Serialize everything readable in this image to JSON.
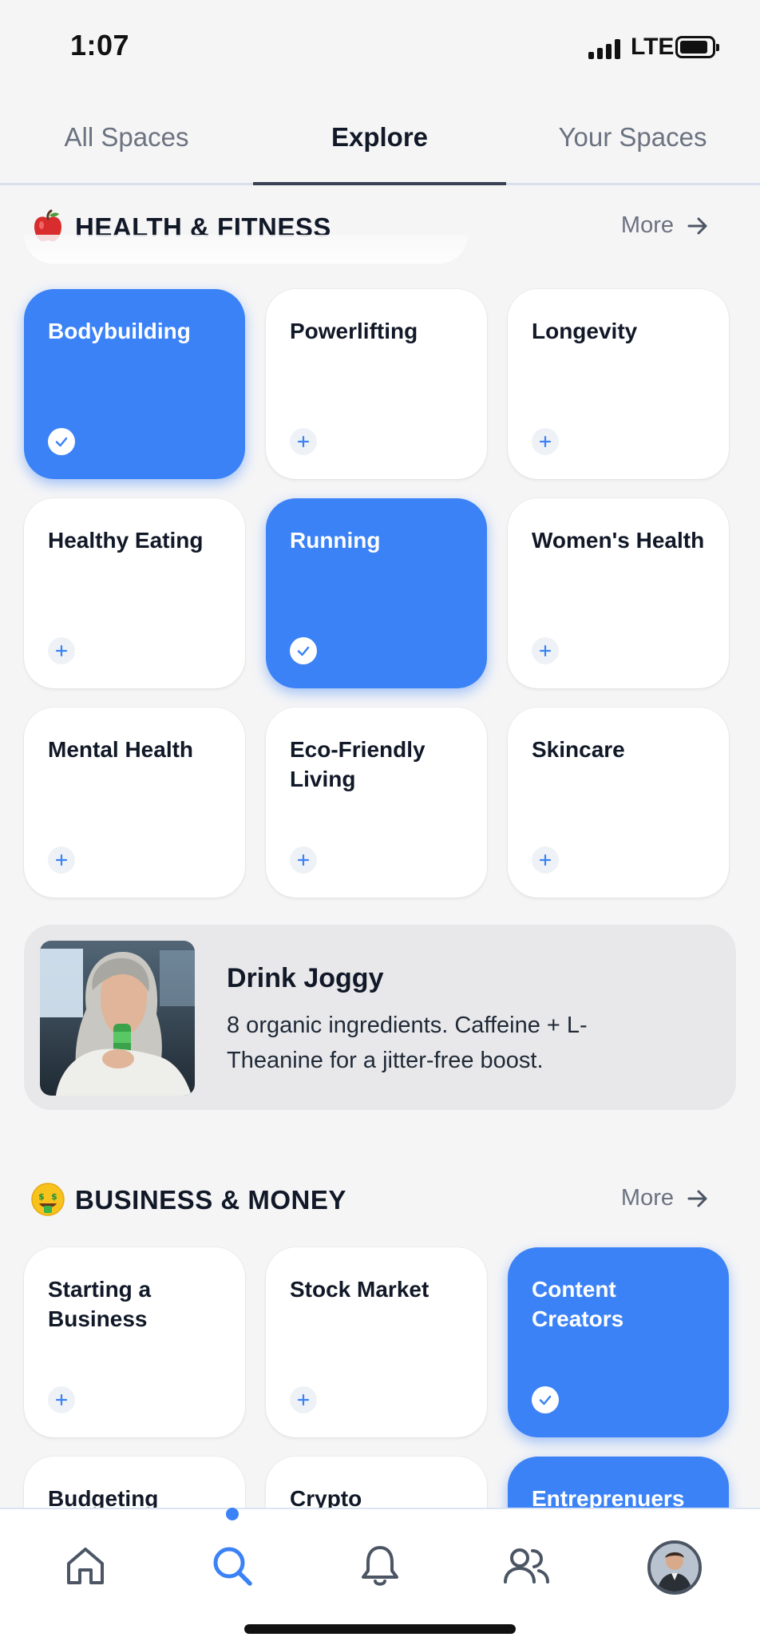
{
  "status_bar": {
    "time": "1:07",
    "network": "LTE"
  },
  "tabs": [
    {
      "label": "All Spaces",
      "active": false
    },
    {
      "label": "Explore",
      "active": true
    },
    {
      "label": "Your Spaces",
      "active": false
    }
  ],
  "sections": {
    "health": {
      "emoji_icon": "apple-icon",
      "title": "HEALTH & FITNESS",
      "more_label": "More",
      "cards": [
        {
          "label": "Bodybuilding",
          "selected": true
        },
        {
          "label": "Powerlifting",
          "selected": false
        },
        {
          "label": "Longevity",
          "selected": false
        },
        {
          "label": "Healthy Eating",
          "selected": false
        },
        {
          "label": "Running",
          "selected": true
        },
        {
          "label": "Women's Health",
          "selected": false
        },
        {
          "label": "Mental Health",
          "selected": false
        },
        {
          "label": "Eco-Friendly Living",
          "selected": false
        },
        {
          "label": "Skincare",
          "selected": false
        }
      ]
    },
    "business": {
      "emoji_icon": "money-mouth-face-icon",
      "title": "BUSINESS & MONEY",
      "more_label": "More",
      "cards": [
        {
          "label": "Starting a Business",
          "selected": false
        },
        {
          "label": "Stock Market",
          "selected": false
        },
        {
          "label": "Content Creators",
          "selected": true
        },
        {
          "label": "Budgeting",
          "selected": false
        },
        {
          "label": "Crypto",
          "selected": false
        },
        {
          "label": "Entreprenuers",
          "selected": true
        }
      ]
    }
  },
  "ad": {
    "title": "Drink Joggy",
    "description": "8 organic ingredients. Caffeine + L-Theanine for a jitter-free boost."
  },
  "bottom_nav": {
    "items": [
      {
        "name": "home",
        "icon": "home-icon",
        "active": false
      },
      {
        "name": "search",
        "icon": "search-icon",
        "active": true
      },
      {
        "name": "notifications",
        "icon": "bell-icon",
        "active": false
      },
      {
        "name": "people",
        "icon": "people-icon",
        "active": false
      },
      {
        "name": "profile",
        "icon": "avatar",
        "active": false
      }
    ]
  },
  "colors": {
    "accent": "#3b82f6",
    "background": "#f5f5f6",
    "card": "#ffffff",
    "text_primary": "#111827",
    "text_secondary": "#6b7280"
  }
}
